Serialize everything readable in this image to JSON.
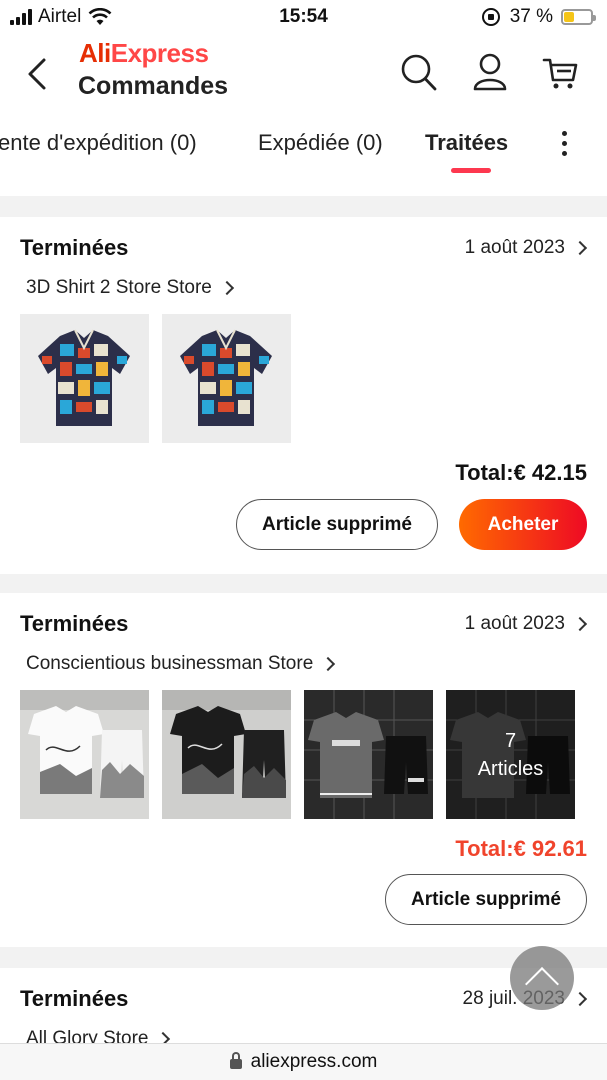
{
  "status_bar": {
    "carrier": "Airtel",
    "time": "15:54",
    "battery": "37 %"
  },
  "header": {
    "brand_ali": "Ali",
    "brand_express": "Express",
    "title": "Commandes"
  },
  "tabs": [
    {
      "label": "ente d'expédition (0)"
    },
    {
      "label": "Expédiée (0)"
    },
    {
      "label": "Traitées"
    }
  ],
  "orders": [
    {
      "status": "Terminées",
      "date": "1 août 2023",
      "store": "3D Shirt 2 Store Store",
      "total": "Total:€ 42.15",
      "btn_deleted": "Article supprimé",
      "btn_buy": "Acheter"
    },
    {
      "status": "Terminées",
      "date": "1 août 2023",
      "store": "Conscientious businessman Store",
      "more_count": "7",
      "more_label": "Articles",
      "total": "Total:€ 92.61",
      "btn_deleted": "Article supprimé"
    },
    {
      "status": "Terminées",
      "date": "28 juil. 2023",
      "store": "All Glory Store"
    }
  ],
  "url": "aliexpress.com",
  "colors": {
    "accent": "#fd384f",
    "total_red": "#f0442c"
  }
}
